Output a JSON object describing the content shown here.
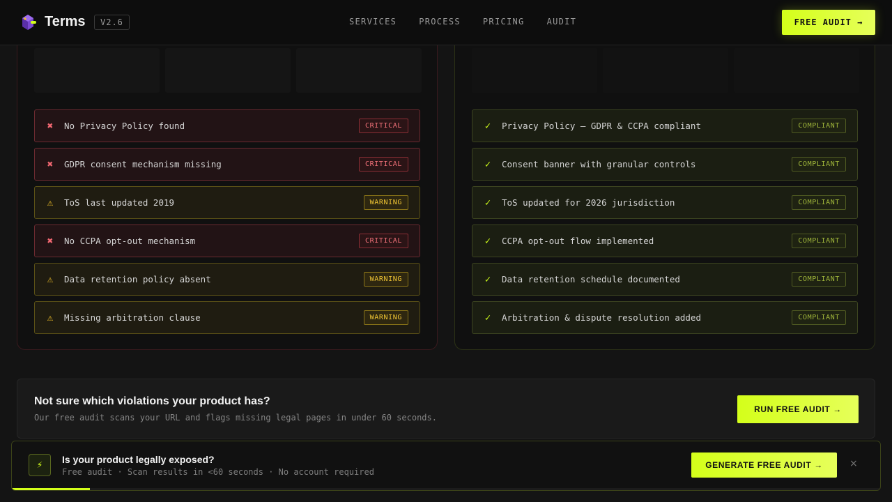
{
  "nav": {
    "brand": "Terms",
    "version": "V2.6",
    "links": [
      "SERVICES",
      "PROCESS",
      "PRICING",
      "AUDIT"
    ],
    "cta": "FREE AUDIT →"
  },
  "before": {
    "items": [
      {
        "icon": "✖",
        "text": "No Privacy Policy found",
        "tag": "CRITICAL",
        "severity": "critical"
      },
      {
        "icon": "✖",
        "text": "GDPR consent mechanism missing",
        "tag": "CRITICAL",
        "severity": "critical"
      },
      {
        "icon": "⚠",
        "text": "ToS last updated 2019",
        "tag": "WARNING",
        "severity": "warning"
      },
      {
        "icon": "✖",
        "text": "No CCPA opt-out mechanism",
        "tag": "CRITICAL",
        "severity": "critical"
      },
      {
        "icon": "⚠",
        "text": "Data retention policy absent",
        "tag": "WARNING",
        "severity": "warning"
      },
      {
        "icon": "⚠",
        "text": "Missing arbitration clause",
        "tag": "WARNING",
        "severity": "warning"
      }
    ]
  },
  "after": {
    "items": [
      {
        "icon": "✓",
        "text": "Privacy Policy — GDPR & CCPA compliant",
        "tag": "COMPLIANT"
      },
      {
        "icon": "✓",
        "text": "Consent banner with granular controls",
        "tag": "COMPLIANT"
      },
      {
        "icon": "✓",
        "text": "ToS updated for 2026 jurisdiction",
        "tag": "COMPLIANT"
      },
      {
        "icon": "✓",
        "text": "CCPA opt-out flow implemented",
        "tag": "COMPLIANT"
      },
      {
        "icon": "✓",
        "text": "Data retention schedule documented",
        "tag": "COMPLIANT"
      },
      {
        "icon": "✓",
        "text": "Arbitration & dispute resolution added",
        "tag": "COMPLIANT"
      }
    ]
  },
  "cta": {
    "title": "Not sure which violations your product has?",
    "subtitle": "Our free audit scans your URL and flags missing legal pages in under 60 seconds.",
    "button": "RUN FREE AUDIT →"
  },
  "toast": {
    "icon": "⚡",
    "title": "Is your product legally exposed?",
    "subtitle": "Free audit · Scan results in <60 seconds · No account required",
    "button": "GENERATE FREE AUDIT →",
    "close": "×",
    "progress_fraction": 0.09
  },
  "colors": {
    "accent": "#d4ff1a",
    "critical": "#f26872",
    "warning": "#f2c028",
    "background": "#141414"
  }
}
